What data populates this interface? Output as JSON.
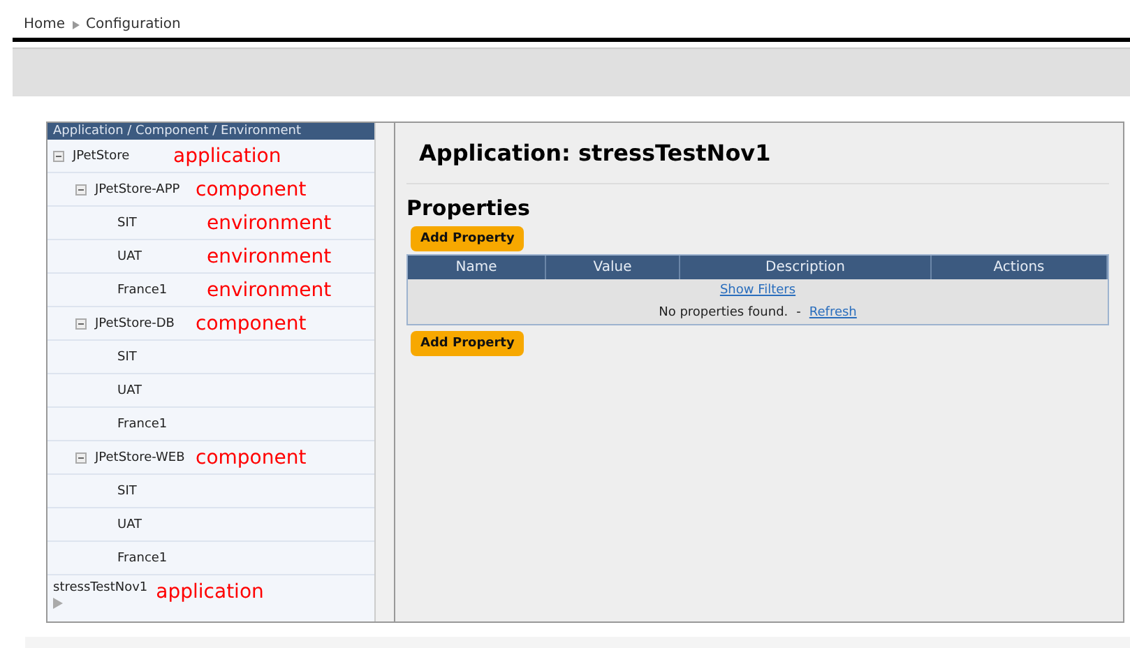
{
  "breadcrumb": [
    "Home",
    "Configuration"
  ],
  "tree": {
    "heading": "Application / Component / Environment",
    "items": [
      {
        "label": "JPetStore",
        "annotation": "application",
        "expanded": true,
        "children": [
          {
            "label": "JPetStore-APP",
            "annotation": "component",
            "expanded": true,
            "children": [
              {
                "label": "SIT",
                "annotation": "environment"
              },
              {
                "label": "UAT",
                "annotation": "environment"
              },
              {
                "label": "France1",
                "annotation": "environment"
              }
            ]
          },
          {
            "label": "JPetStore-DB",
            "annotation": "component",
            "expanded": true,
            "children": [
              {
                "label": "SIT"
              },
              {
                "label": "UAT"
              },
              {
                "label": "France1"
              }
            ]
          },
          {
            "label": "JPetStore-WEB",
            "annotation": "component",
            "expanded": true,
            "children": [
              {
                "label": "SIT"
              },
              {
                "label": "UAT"
              },
              {
                "label": "France1"
              }
            ]
          }
        ]
      },
      {
        "label": "stressTestNov1",
        "annotation": "application",
        "expanded": false
      }
    ]
  },
  "detail": {
    "title": "Application: stressTestNov1",
    "section": "Properties",
    "add_buttons": [
      "Add Property",
      "Add Property"
    ],
    "table": {
      "columns": [
        "Name",
        "Value",
        "Description",
        "Actions"
      ],
      "filter_link": "Show Filters",
      "empty_message": "No properties found.",
      "separator": "-",
      "refresh_link": "Refresh"
    }
  }
}
